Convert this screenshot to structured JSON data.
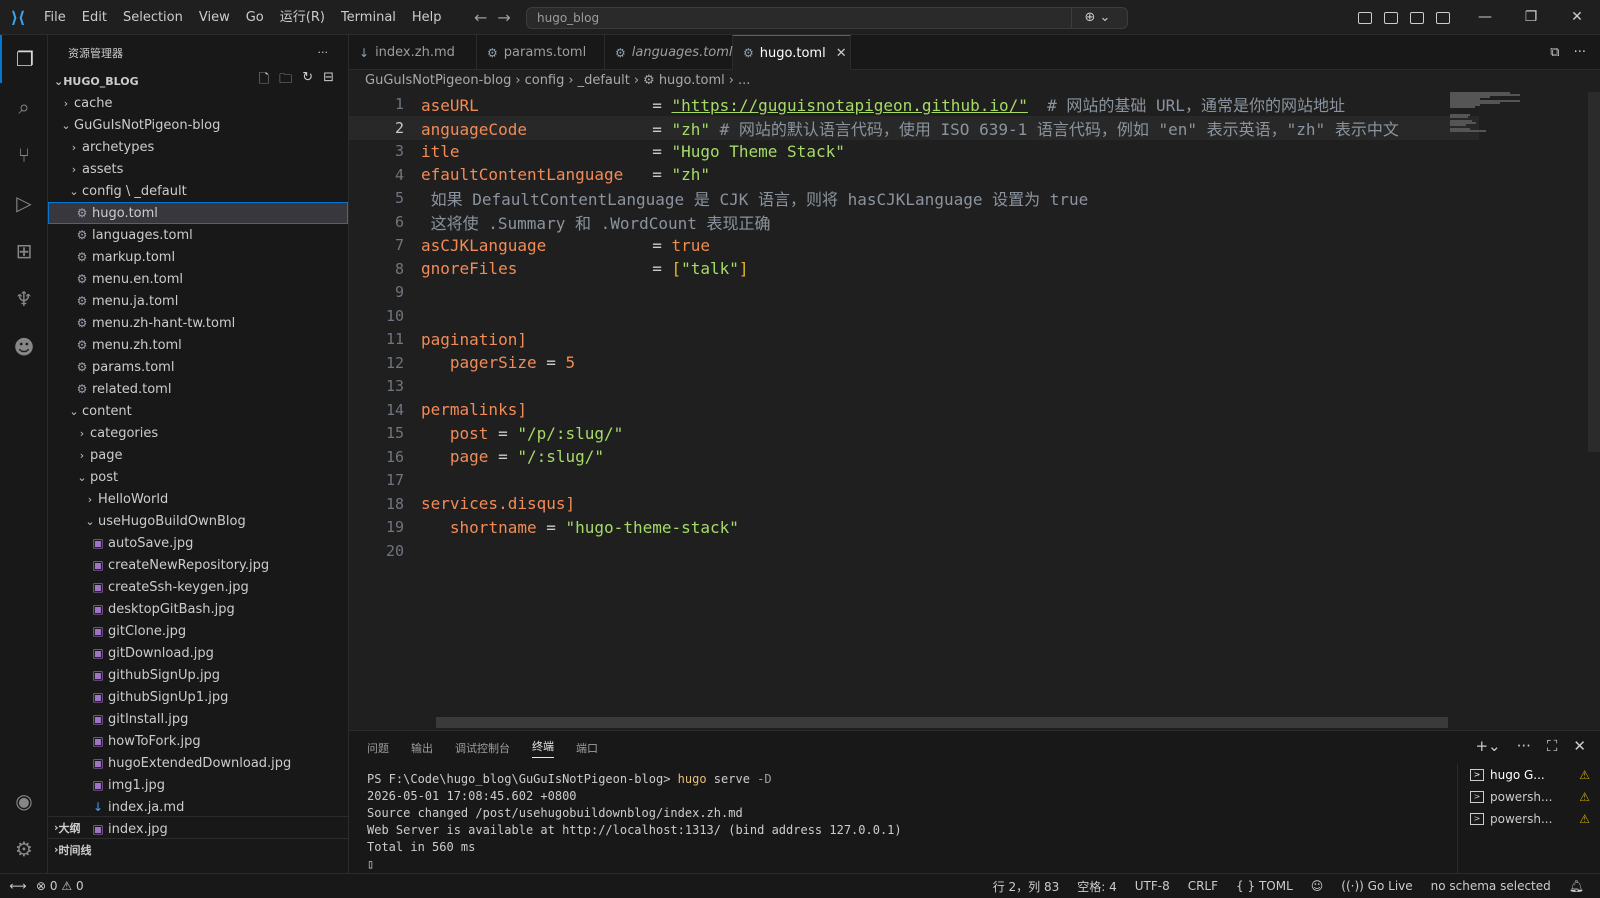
{
  "menu": [
    "File",
    "Edit",
    "Selection",
    "View",
    "Go",
    "运行(R)",
    "Terminal",
    "Help"
  ],
  "command_center": {
    "text": "hugo_blog"
  },
  "sidebar": {
    "title": "资源管理器",
    "more": "···",
    "root": "HUGO_BLOG",
    "tree": [
      {
        "label": "cache",
        "depth": 0,
        "kind": "folder",
        "open": false
      },
      {
        "label": "GuGuIsNotPigeon-blog",
        "depth": 0,
        "kind": "folder",
        "open": true
      },
      {
        "label": "archetypes",
        "depth": 1,
        "kind": "folder",
        "open": false
      },
      {
        "label": "assets",
        "depth": 1,
        "kind": "folder",
        "open": false
      },
      {
        "label": "config \\ _default",
        "depth": 1,
        "kind": "folder",
        "open": true
      },
      {
        "label": "hugo.toml",
        "depth": 2,
        "kind": "gear",
        "selected": true
      },
      {
        "label": "languages.toml",
        "depth": 2,
        "kind": "gear"
      },
      {
        "label": "markup.toml",
        "depth": 2,
        "kind": "gear"
      },
      {
        "label": "menu.en.toml",
        "depth": 2,
        "kind": "gear"
      },
      {
        "label": "menu.ja.toml",
        "depth": 2,
        "kind": "gear"
      },
      {
        "label": "menu.zh-hant-tw.toml",
        "depth": 2,
        "kind": "gear"
      },
      {
        "label": "menu.zh.toml",
        "depth": 2,
        "kind": "gear"
      },
      {
        "label": "params.toml",
        "depth": 2,
        "kind": "gear"
      },
      {
        "label": "related.toml",
        "depth": 2,
        "kind": "gear"
      },
      {
        "label": "content",
        "depth": 1,
        "kind": "folder",
        "open": true
      },
      {
        "label": "categories",
        "depth": 2,
        "kind": "folder",
        "open": false
      },
      {
        "label": "page",
        "depth": 2,
        "kind": "folder",
        "open": false
      },
      {
        "label": "post",
        "depth": 2,
        "kind": "folder",
        "open": true
      },
      {
        "label": "HelloWorld",
        "depth": 3,
        "kind": "folder",
        "open": false
      },
      {
        "label": "useHugoBuildOwnBlog",
        "depth": 3,
        "kind": "folder",
        "open": true
      },
      {
        "label": "autoSave.jpg",
        "depth": 4,
        "kind": "img"
      },
      {
        "label": "createNewRepository.jpg",
        "depth": 4,
        "kind": "img"
      },
      {
        "label": "createSsh-keygen.jpg",
        "depth": 4,
        "kind": "img"
      },
      {
        "label": "desktopGitBash.jpg",
        "depth": 4,
        "kind": "img"
      },
      {
        "label": "gitClone.jpg",
        "depth": 4,
        "kind": "img"
      },
      {
        "label": "gitDownload.jpg",
        "depth": 4,
        "kind": "img"
      },
      {
        "label": "githubSignUp.jpg",
        "depth": 4,
        "kind": "img"
      },
      {
        "label": "githubSignUp1.jpg",
        "depth": 4,
        "kind": "img"
      },
      {
        "label": "gitInstall.jpg",
        "depth": 4,
        "kind": "img"
      },
      {
        "label": "howToFork.jpg",
        "depth": 4,
        "kind": "img"
      },
      {
        "label": "hugoExtendedDownload.jpg",
        "depth": 4,
        "kind": "img"
      },
      {
        "label": "img1.jpg",
        "depth": 4,
        "kind": "img"
      },
      {
        "label": "index.ja.md",
        "depth": 4,
        "kind": "md"
      },
      {
        "label": "index.jpg",
        "depth": 4,
        "kind": "img"
      }
    ],
    "outline_label": "大纲",
    "timeline_label": "时间线"
  },
  "tabs": [
    {
      "label": "index.zh.md",
      "icon": "↓",
      "italic": false,
      "active": false
    },
    {
      "label": "params.toml",
      "icon": "⚙",
      "italic": false,
      "active": false
    },
    {
      "label": "languages.toml",
      "icon": "⚙",
      "italic": true,
      "active": false
    },
    {
      "label": "hugo.toml",
      "icon": "⚙",
      "italic": false,
      "active": true
    }
  ],
  "tab_close": "✕",
  "breadcrumb": [
    "GuGuIsNotPigeon-blog",
    "config",
    "_default",
    "⚙ hugo.toml",
    "..."
  ],
  "editor": {
    "current_line": 2,
    "lines": [
      {
        "n": "1",
        "tokens": [
          [
            "k",
            "aseURL"
          ],
          [
            "t",
            "                  = "
          ],
          [
            "su",
            "\"https://guguisnotapigeon.github.io/\""
          ],
          [
            "c",
            "  # 网站的基础 URL，通常是你的网站地址"
          ]
        ]
      },
      {
        "n": "2",
        "tokens": [
          [
            "k",
            "anguageCode"
          ],
          [
            "t",
            "             = "
          ],
          [
            "s",
            "\"zh\""
          ],
          [
            "c",
            " # 网站的默认语言代码，使用 ISO 639-1 语言代码，例如 \"en\" 表示英语，\"zh\" 表示中文"
          ]
        ]
      },
      {
        "n": "3",
        "tokens": [
          [
            "k",
            "itle"
          ],
          [
            "t",
            "                    = "
          ],
          [
            "s",
            "\"Hugo Theme Stack\""
          ]
        ]
      },
      {
        "n": "4",
        "tokens": [
          [
            "k",
            "efaultContentLanguage"
          ],
          [
            "t",
            "   = "
          ],
          [
            "s",
            "\"zh\""
          ]
        ]
      },
      {
        "n": "5",
        "tokens": [
          [
            "c",
            " 如果 DefaultContentLanguage 是 CJK 语言，则将 hasCJKLanguage 设置为 true"
          ]
        ]
      },
      {
        "n": "6",
        "tokens": [
          [
            "c",
            " 这将使 .Summary 和 .WordCount 表现正确"
          ]
        ]
      },
      {
        "n": "7",
        "tokens": [
          [
            "k",
            "asCJKLanguage"
          ],
          [
            "t",
            "           = "
          ],
          [
            "n",
            "true"
          ]
        ]
      },
      {
        "n": "8",
        "tokens": [
          [
            "k",
            "gnoreFiles"
          ],
          [
            "t",
            "              = "
          ],
          [
            "b",
            "["
          ],
          [
            "s",
            "\"talk\""
          ],
          [
            "b",
            "]"
          ]
        ]
      },
      {
        "n": "9",
        "tokens": []
      },
      {
        "n": "10",
        "tokens": []
      },
      {
        "n": "11",
        "tokens": [
          [
            "k",
            "pagination]"
          ]
        ]
      },
      {
        "n": "12",
        "tokens": [
          [
            "t",
            "   "
          ],
          [
            "k",
            "pagerSize"
          ],
          [
            "t",
            " = "
          ],
          [
            "n",
            "5"
          ]
        ]
      },
      {
        "n": "13",
        "tokens": []
      },
      {
        "n": "14",
        "tokens": [
          [
            "k",
            "permalinks]"
          ]
        ]
      },
      {
        "n": "15",
        "tokens": [
          [
            "t",
            "   "
          ],
          [
            "k",
            "post"
          ],
          [
            "t",
            " = "
          ],
          [
            "s",
            "\"/p/:slug/\""
          ]
        ]
      },
      {
        "n": "16",
        "tokens": [
          [
            "t",
            "   "
          ],
          [
            "k",
            "page"
          ],
          [
            "t",
            " = "
          ],
          [
            "s",
            "\"/:slug/\""
          ]
        ]
      },
      {
        "n": "17",
        "tokens": []
      },
      {
        "n": "18",
        "tokens": [
          [
            "k",
            "services.disqus]"
          ]
        ]
      },
      {
        "n": "19",
        "tokens": [
          [
            "t",
            "   "
          ],
          [
            "k",
            "shortname"
          ],
          [
            "t",
            " = "
          ],
          [
            "s",
            "\"hugo-theme-stack\""
          ]
        ]
      },
      {
        "n": "20",
        "tokens": []
      }
    ]
  },
  "panel": {
    "tabs": [
      "问题",
      "输出",
      "调试控制台",
      "终端",
      "端口"
    ],
    "active_tab": "终端",
    "terminal_lines": [
      [
        [
          "t",
          "PS F:\\Code\\hugo_blog\\GuGuIsNotPigeon-blog> "
        ],
        [
          "cmd",
          "hugo"
        ],
        [
          "t",
          " serve "
        ],
        [
          "flag",
          "-D"
        ]
      ],
      [
        [
          "t",
          "2026-05-01 17:08:45.602 +0800"
        ]
      ],
      [
        [
          "t",
          "Source changed /post/usehugobuildownblog/index.zh.md"
        ]
      ],
      [
        [
          "t",
          "Web Server is available at http://localhost:1313/ (bind address 127.0.0.1)"
        ]
      ],
      [
        [
          "t",
          "Total in 560 ms"
        ]
      ],
      [
        [
          "t",
          "▯"
        ]
      ]
    ],
    "terminals": [
      {
        "label": "hugo G...",
        "active": true
      },
      {
        "label": "powersh...",
        "active": false
      },
      {
        "label": "powersh...",
        "active": false
      }
    ]
  },
  "statusbar": {
    "errors": "0",
    "warnings": "0",
    "position": "行 2，列 83",
    "spaces": "空格: 4",
    "encoding": "UTF-8",
    "eol": "CRLF",
    "language": "TOML",
    "golive": "Go Live",
    "schema": "no schema selected"
  },
  "colors": {
    "accent": "#0078d4",
    "key": "#f38b56",
    "string": "#a6db66",
    "comment": "#8b949e"
  }
}
